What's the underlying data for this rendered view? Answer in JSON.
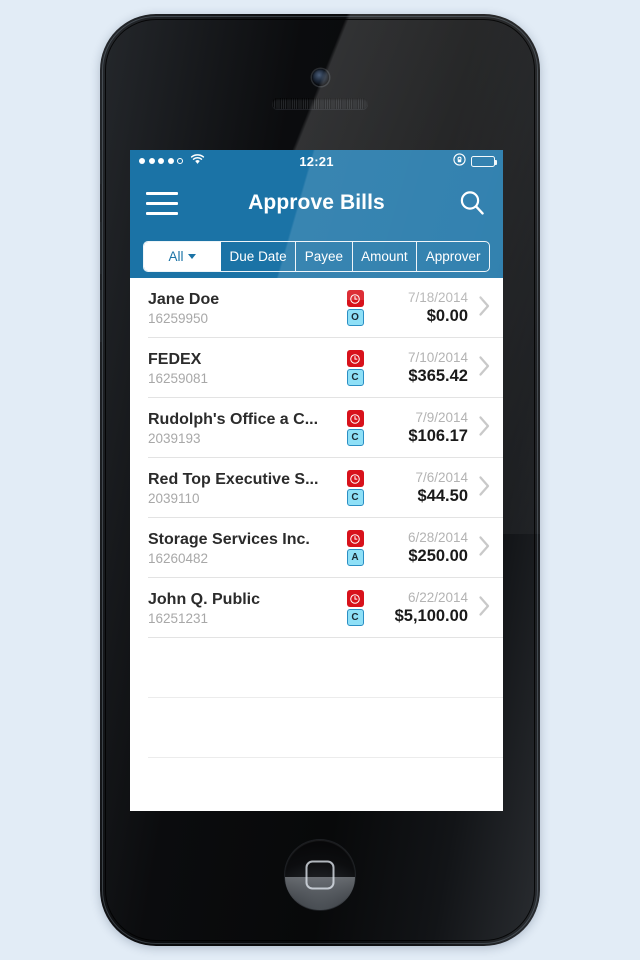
{
  "status_bar": {
    "signal_dots_filled": 4,
    "signal_dots_total": 5,
    "wifi_icon": "wifi-icon",
    "time": "12:21",
    "rotation_lock_icon": "rotation-lock-icon",
    "battery_icon": "battery-full-icon"
  },
  "nav": {
    "menu_icon": "hamburger-menu-icon",
    "title": "Approve Bills",
    "search_icon": "search-icon"
  },
  "filters": {
    "segments": [
      {
        "label": "All",
        "has_caret": true,
        "active": true
      },
      {
        "label": "Due Date",
        "has_caret": false,
        "active": false
      },
      {
        "label": "Payee",
        "has_caret": false,
        "active": false
      },
      {
        "label": "Amount",
        "has_caret": false,
        "active": false
      },
      {
        "label": "Approver",
        "has_caret": false,
        "active": false
      }
    ]
  },
  "colors": {
    "header_blue": "#1b73a6",
    "badge_red": "#d8121b",
    "badge_blue": "#8fe0f7",
    "page_background": "#e2ecf6"
  },
  "bills": [
    {
      "payee": "Jane Doe",
      "bill_number": "16259950",
      "status_icon": "clock-icon",
      "status_letter": "O",
      "due_date": "7/18/2014",
      "amount": "$0.00"
    },
    {
      "payee": "FEDEX",
      "bill_number": "16259081",
      "status_icon": "clock-icon",
      "status_letter": "C",
      "due_date": "7/10/2014",
      "amount": "$365.42"
    },
    {
      "payee": "Rudolph's Office a C...",
      "bill_number": "2039193",
      "status_icon": "clock-icon",
      "status_letter": "C",
      "due_date": "7/9/2014",
      "amount": "$106.17"
    },
    {
      "payee": "Red Top Executive S...",
      "bill_number": "2039110",
      "status_icon": "clock-icon",
      "status_letter": "C",
      "due_date": "7/6/2014",
      "amount": "$44.50"
    },
    {
      "payee": "Storage Services Inc.",
      "bill_number": "16260482",
      "status_icon": "clock-icon",
      "status_letter": "A",
      "due_date": "6/28/2014",
      "amount": "$250.00"
    },
    {
      "payee": "John Q. Public",
      "bill_number": "16251231",
      "status_icon": "clock-icon",
      "status_letter": "C",
      "due_date": "6/22/2014",
      "amount": "$5,100.00"
    }
  ],
  "empty_rows": 3
}
